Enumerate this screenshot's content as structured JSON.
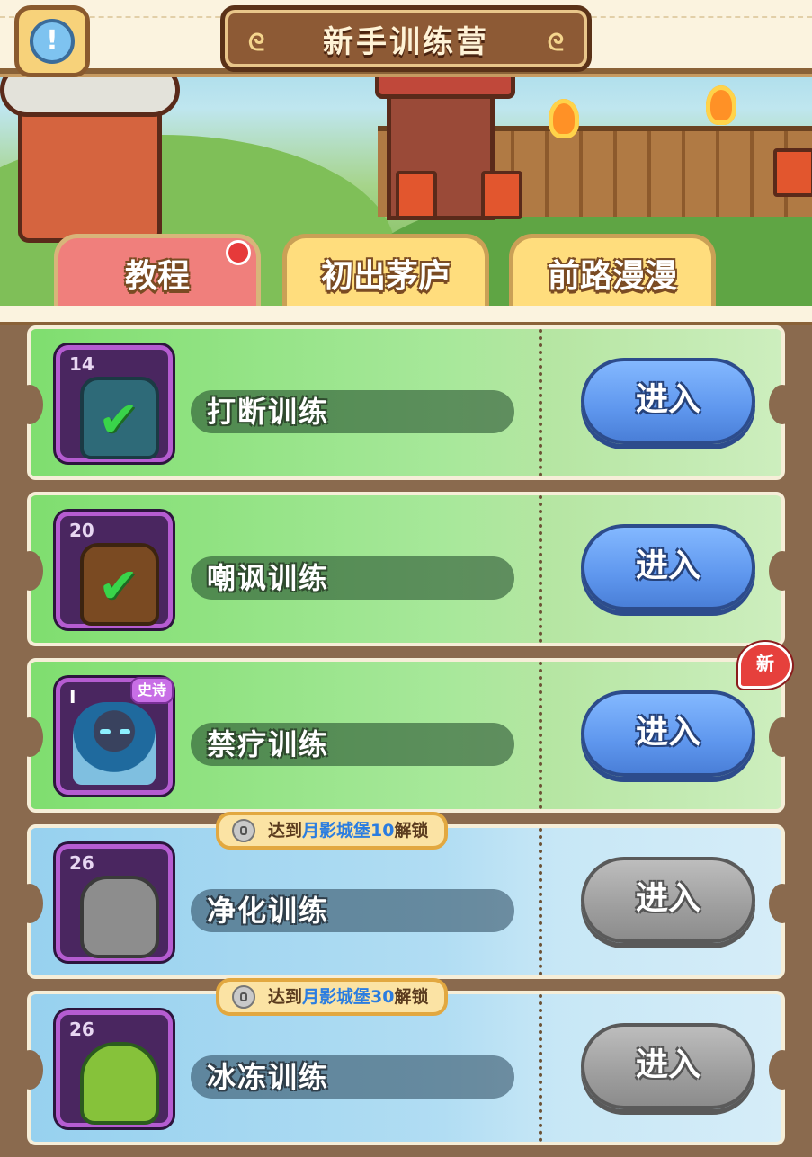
{
  "header": {
    "title": "新手训练营",
    "info_glyph": "!"
  },
  "tabs": [
    {
      "label": "教程",
      "active": true,
      "has_red_dot": true
    },
    {
      "label": "初出茅庐",
      "active": false
    },
    {
      "label": "前路漫漫",
      "active": false
    }
  ],
  "trainings": [
    {
      "name": "打断训练",
      "level": "14",
      "completed": true,
      "button": "进入",
      "locked": false,
      "theme": "green"
    },
    {
      "name": "嘲讽训练",
      "level": "20",
      "completed": true,
      "button": "进入",
      "locked": false,
      "theme": "green"
    },
    {
      "name": "禁疗训练",
      "level": "I",
      "tag": "史诗",
      "button": "进入",
      "locked": false,
      "is_new": true,
      "new_label": "新",
      "theme": "green"
    },
    {
      "name": "净化训练",
      "level": "26",
      "button": "进入",
      "locked": true,
      "lock_prefix": "达到",
      "lock_place": "月影城堡10",
      "lock_suffix": "解锁",
      "theme": "blue"
    },
    {
      "name": "冰冻训练",
      "level": "26",
      "button": "进入",
      "locked": true,
      "lock_prefix": "达到",
      "lock_place": "月影城堡30",
      "lock_suffix": "解锁",
      "theme": "blue"
    }
  ],
  "colors": {
    "active_tab": "#f07f7c",
    "inactive_tab": "#ffdd7d",
    "enter_button": "#5f97ee",
    "disabled_button": "#9e9e9e",
    "lock_highlight": "#2b7de0"
  },
  "icons": {
    "info": "info-icon",
    "check": "check-icon",
    "lock": "lock-icon"
  }
}
